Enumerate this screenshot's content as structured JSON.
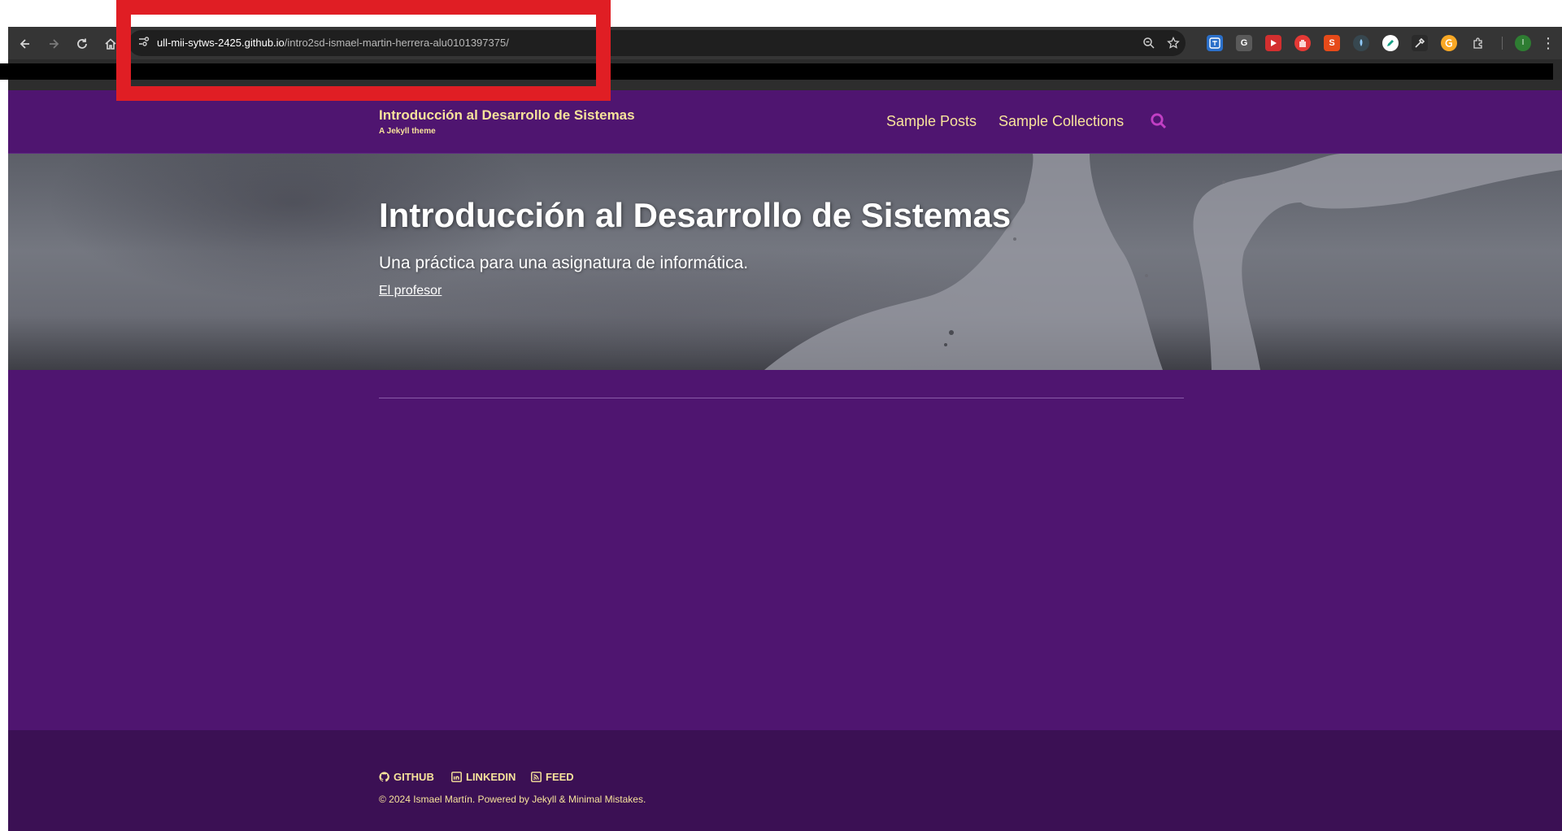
{
  "browser": {
    "url_host": "ull-mii-sytws-2425.github.io",
    "url_path": "/intro2sd-ismael-martin-herrera-alu0101397375/",
    "profile_initial": "I",
    "extensions": [
      {
        "name": "translate-extension-icon",
        "label": "",
        "color": "#2a6fc9"
      },
      {
        "name": "g-extension-icon",
        "label": "G",
        "color": "#5a5a5a"
      },
      {
        "name": "media-extension-icon",
        "label": "",
        "color": "#d32f2f"
      },
      {
        "name": "adblock-extension-icon",
        "label": "",
        "color": "#e53935"
      },
      {
        "name": "s-extension-icon",
        "label": "S",
        "color": "#e64a19"
      },
      {
        "name": "rocket-extension-icon",
        "label": "",
        "color": "#37474f"
      },
      {
        "name": "pencil-extension-icon",
        "label": "",
        "color": "#ffffff"
      },
      {
        "name": "eyedropper-extension-icon",
        "label": "",
        "color": "#2b2b2b"
      },
      {
        "name": "grammarly-extension-icon",
        "label": "",
        "color": "#f9a825"
      }
    ]
  },
  "site": {
    "title": "Introducción al Desarrollo de Sistemas",
    "subtitle": "A Jekyll theme"
  },
  "nav": {
    "items": [
      {
        "label": "Sample Posts"
      },
      {
        "label": "Sample Collections"
      }
    ]
  },
  "hero": {
    "title": "Introducción al Desarrollo de Sistemas",
    "excerpt": "Una práctica para una asignatura de informática.",
    "link": "El profesor"
  },
  "footer": {
    "links": [
      {
        "label": "GITHUB"
      },
      {
        "label": "LINKEDIN"
      },
      {
        "label": "FEED"
      }
    ],
    "copyright": "© 2024 Ismael Martín. Powered by Jekyll & Minimal Mistakes."
  },
  "colors": {
    "accent": "#f7e39b",
    "background": "#4f1570",
    "footer": "#3b1054",
    "highlight": "#e01e24"
  }
}
